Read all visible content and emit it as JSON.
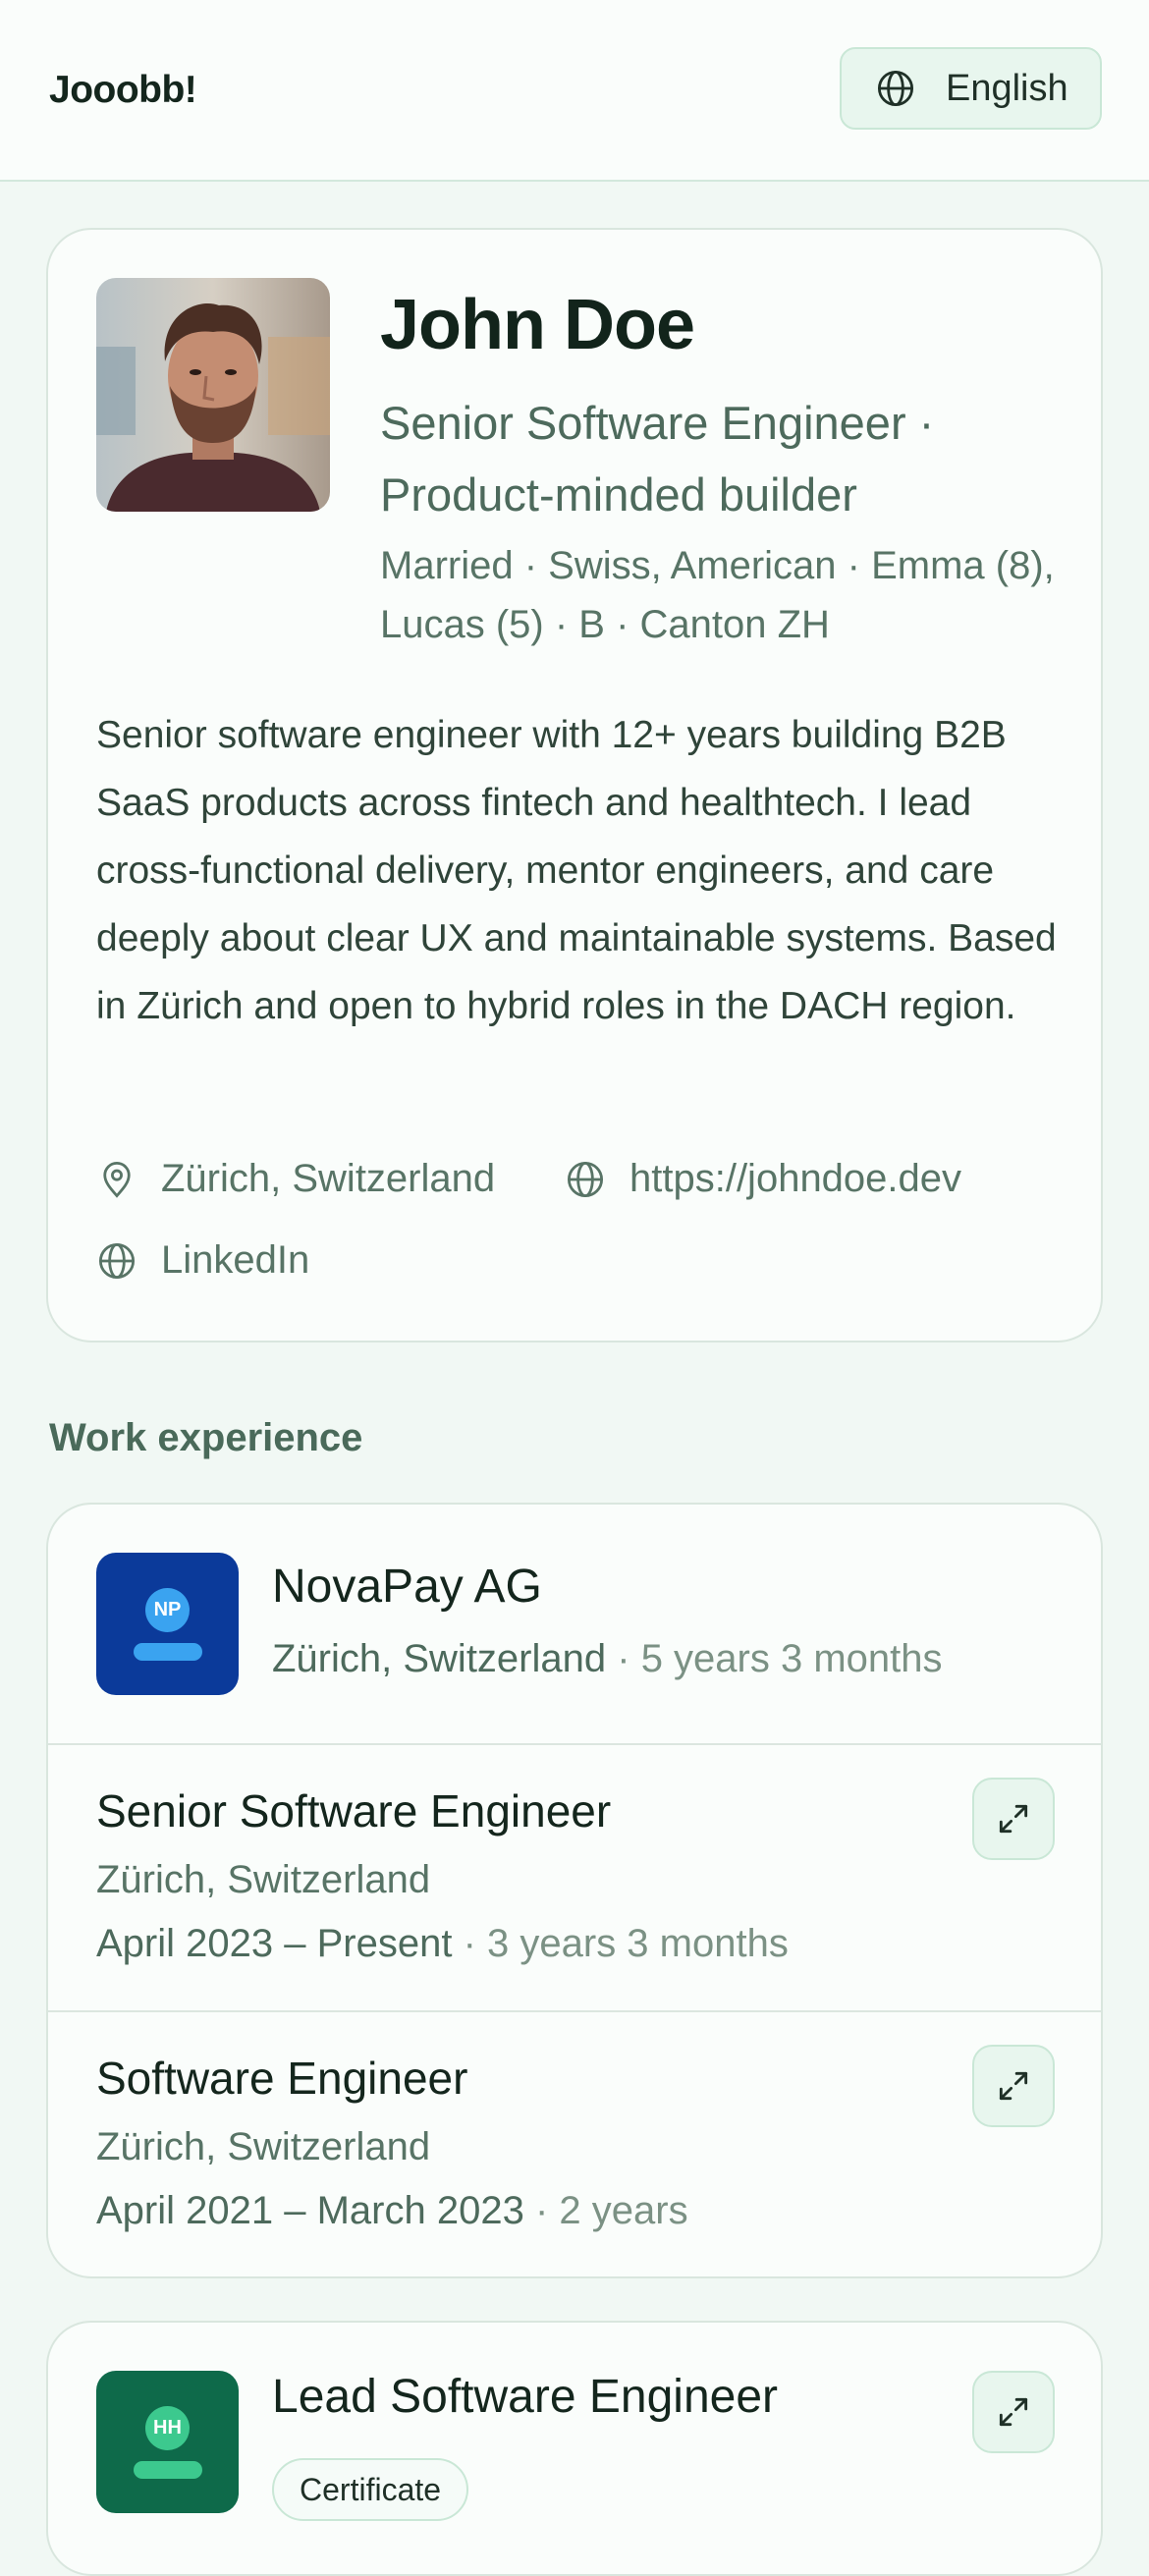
{
  "header": {
    "brand": "Jooobb!",
    "language_label": "English"
  },
  "profile": {
    "name": "John Doe",
    "headline": "Senior Software Engineer · Product-minded builder",
    "meta": "Married · Swiss, American · Emma (8), Lucas (5) · B · Canton ZH",
    "bio": "Senior software engineer with 12+ years building B2B SaaS products across fintech and healthtech. I lead cross-functional delivery, mentor engineers, and care deeply about clear UX and maintainable systems. Based in Zürich and open to hybrid roles in the DACH region.",
    "location": "Zürich, Switzerland",
    "website": "https://johndoe.dev",
    "linkedin": "LinkedIn"
  },
  "work": {
    "section_title": "Work experience",
    "companies": [
      {
        "name": "NovaPay AG",
        "initials": "NP",
        "logo_color": "#0b3a9a",
        "badge_color": "#3aa3f0",
        "location": "Zürich, Switzerland",
        "tenure": "5 years 3 months",
        "roles": [
          {
            "title": "Senior Software Engineer",
            "location": "Zürich, Switzerland",
            "dates": "April 2023 – Present",
            "duration": "3 years 3 months"
          },
          {
            "title": "Software Engineer",
            "location": "Zürich, Switzerland",
            "dates": "April 2021 – March 2023",
            "duration": "2 years"
          }
        ]
      },
      {
        "name": "Lead Software Engineer",
        "initials": "HH",
        "logo_color": "#0e6a4a",
        "badge_color": "#3cc98e",
        "badge": "Certificate"
      }
    ]
  },
  "colors": {
    "accent": "#e8f6ee",
    "accent_border": "#c9e7d6",
    "page_bg": "#f1f8f4",
    "text_muted": "#587466"
  },
  "icons": {
    "language": "globe-icon",
    "location": "map-pin-icon",
    "website": "globe-icon",
    "linkedin": "globe-icon",
    "expand": "expand-arrows-icon"
  }
}
